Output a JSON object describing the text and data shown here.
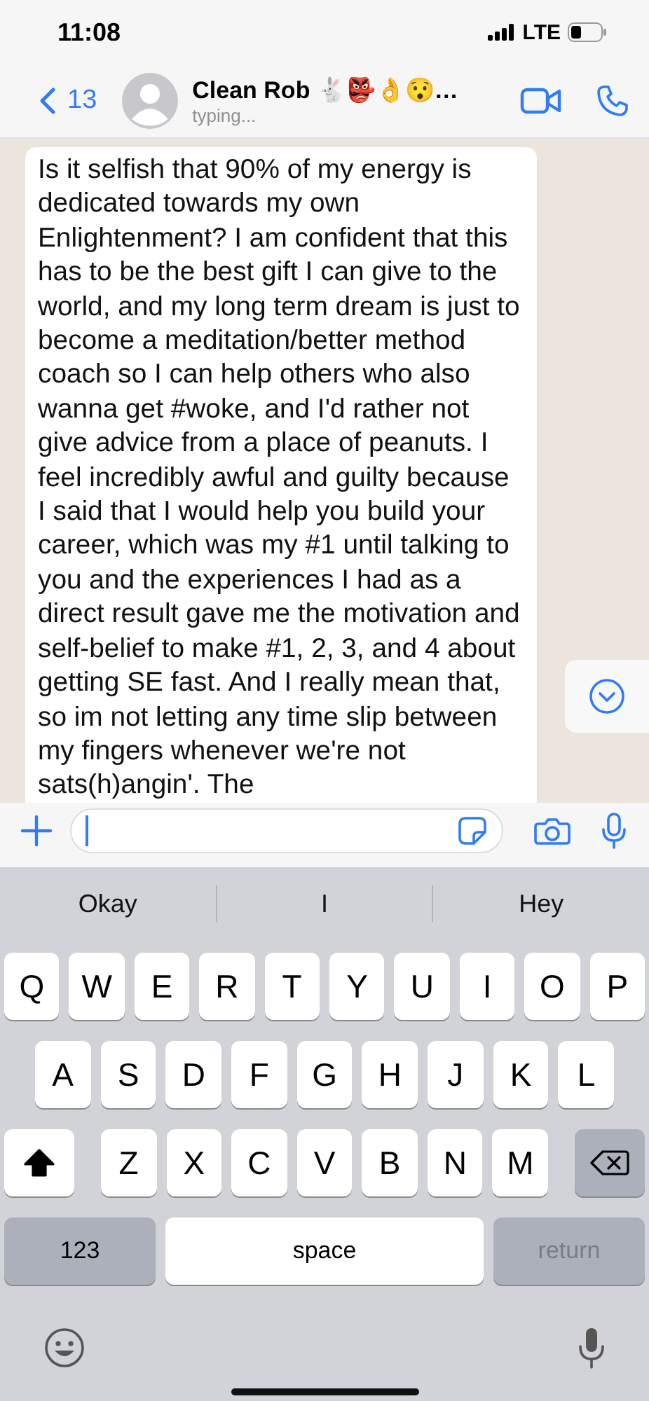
{
  "status_bar": {
    "time": "11:08",
    "network": "LTE"
  },
  "header": {
    "back_count": "13",
    "contact_name": "Clean Rob 🐇👺👌😯…",
    "subtitle": "typing..."
  },
  "messages": [
    {
      "text": "Is it selfish that 90% of my energy is dedicated towards my own Enlightenment? I am confident that this has to be the best gift I can give to the world, and my long term dream is just to become a meditation/better method coach so I can help others who also wanna get #woke, and I'd rather not give advice from a place of peanuts. I feel incredibly awful and guilty because I said that I would help you build your career, which was my #1 until talking to you and the experiences I had as a direct result gave me the motivation and self-belief to make #1, 2, 3, and 4 about getting SE fast. And I really mean that, so im not letting any time slip between my fingers whenever we're not sats(h)angin'. The"
    }
  ],
  "suggestions": [
    "Okay",
    "I",
    "Hey"
  ],
  "keyboard": {
    "top_row": [
      {
        "kind": "letter",
        "label": "Q"
      },
      {
        "kind": "letter",
        "label": "W"
      },
      {
        "kind": "letter",
        "label": "E"
      },
      {
        "kind": "letter",
        "label": "R"
      },
      {
        "kind": "letter",
        "label": "T"
      },
      {
        "kind": "letter",
        "label": "Y"
      },
      {
        "kind": "letter",
        "label": "U"
      },
      {
        "kind": "letter",
        "label": "I"
      },
      {
        "kind": "letter",
        "label": "O"
      },
      {
        "kind": "letter",
        "label": "P"
      }
    ],
    "middle_row": [
      {
        "kind": "letter",
        "label": "A"
      },
      {
        "kind": "letter",
        "label": "S"
      },
      {
        "kind": "letter",
        "label": "D"
      },
      {
        "kind": "letter",
        "label": "F"
      },
      {
        "kind": "letter",
        "label": "G"
      },
      {
        "kind": "letter",
        "label": "H"
      },
      {
        "kind": "letter",
        "label": "J"
      },
      {
        "kind": "letter",
        "label": "K"
      },
      {
        "kind": "letter",
        "label": "L"
      }
    ],
    "lower_row": [
      {
        "kind": "shift",
        "on": true
      },
      {
        "kind": "letter",
        "label": "Z"
      },
      {
        "kind": "letter",
        "label": "X"
      },
      {
        "kind": "letter",
        "label": "C"
      },
      {
        "kind": "letter",
        "label": "V"
      },
      {
        "kind": "letter",
        "label": "B"
      },
      {
        "kind": "letter",
        "label": "N"
      },
      {
        "kind": "letter",
        "label": "M"
      },
      {
        "kind": "backspace"
      }
    ],
    "bottom_row": {
      "numbers_key": "123",
      "space_key": "space",
      "return_key": {
        "label": "return",
        "disabled": true
      }
    }
  }
}
